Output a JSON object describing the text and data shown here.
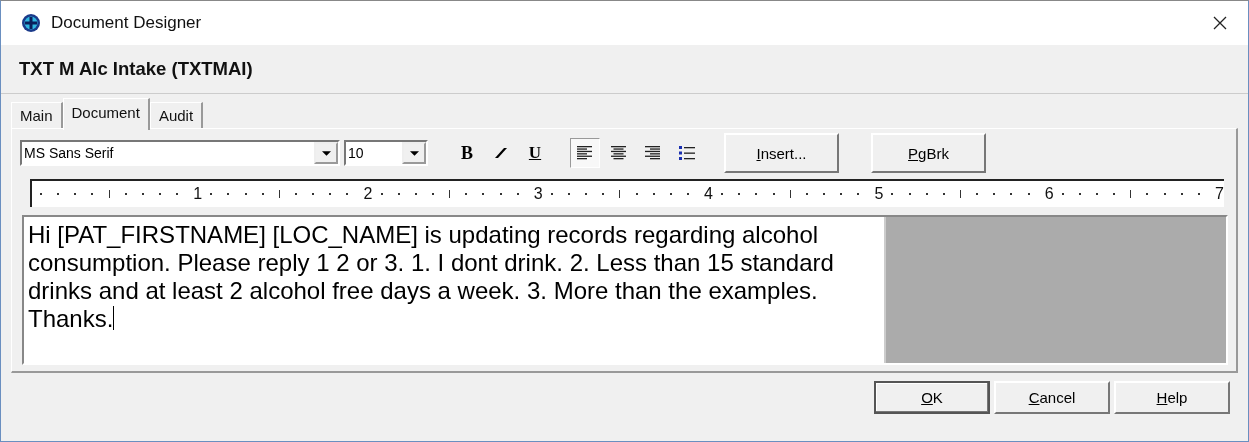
{
  "window": {
    "title": "Document Designer"
  },
  "header": "TXT M Alc Intake (TXTMAI)",
  "tabs": [
    {
      "label": "Main",
      "selected": false
    },
    {
      "label": "Document",
      "selected": true
    },
    {
      "label": "Audit",
      "selected": false
    }
  ],
  "toolbar": {
    "font": "MS Sans Serif",
    "size": "10",
    "format_buttons": [
      {
        "kind": "bold",
        "label": "B"
      },
      {
        "kind": "italic"
      },
      {
        "kind": "underline",
        "label": "U"
      }
    ],
    "alignment": [
      {
        "kind": "left",
        "selected": true
      },
      {
        "kind": "center",
        "selected": false
      },
      {
        "kind": "right",
        "selected": false
      }
    ],
    "buttons": [
      {
        "key": "I",
        "rest": "nsert..."
      },
      {
        "key": "P",
        "rest": "gBrk"
      }
    ]
  },
  "ruler": {
    "labels": [
      "1",
      "2",
      "3",
      "4",
      "5",
      "6",
      "7"
    ]
  },
  "editor": {
    "text": "Hi [PAT_FIRSTNAME] [LOC_NAME] is updating records regarding alcohol consumption. Please reply 1 2 or 3. 1. I dont drink. 2. Less than 15 standard drinks and at least 2 alcohol free days a week. 3. More than the examples. Thanks."
  },
  "buttons": [
    {
      "key": "O",
      "rest": "K",
      "default": true
    },
    {
      "key": "C",
      "rest": "ancel",
      "default": false
    },
    {
      "key": "H",
      "rest": "elp",
      "default": false
    }
  ]
}
